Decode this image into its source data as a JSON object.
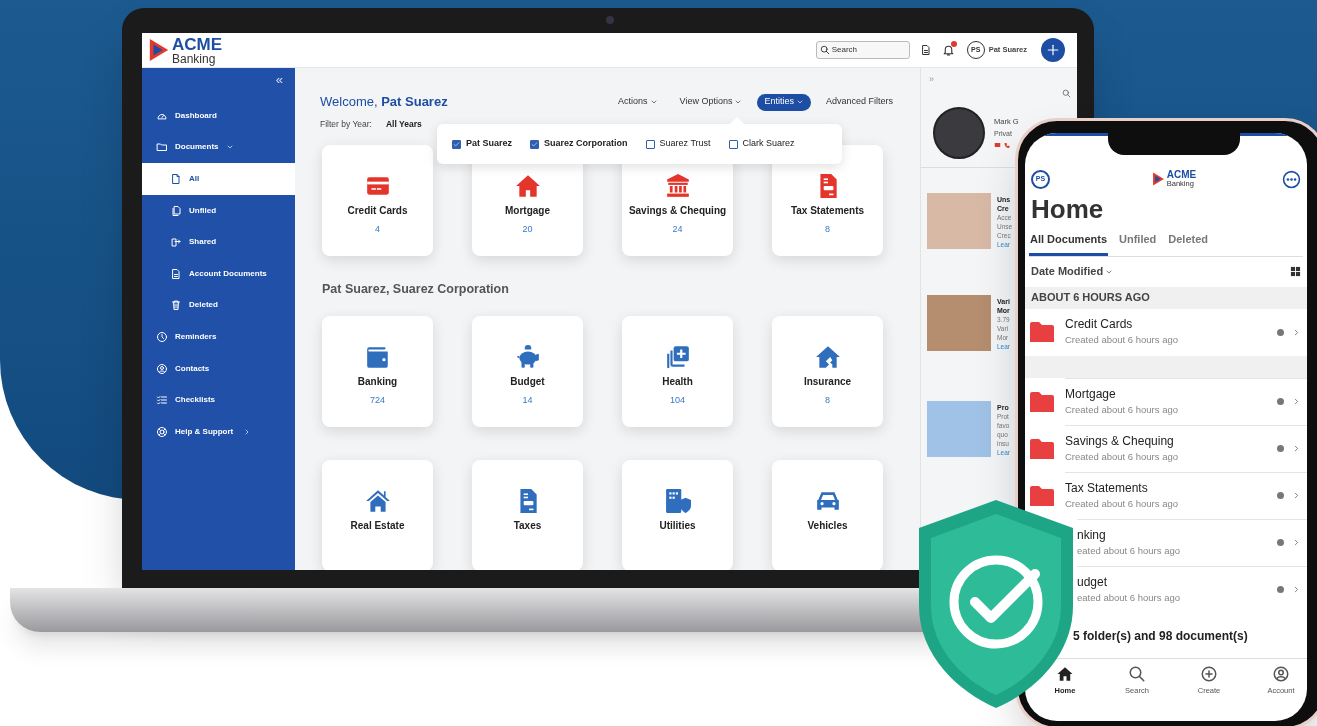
{
  "laptop": {
    "header": {
      "logo_title": "ACME",
      "logo_subtitle": "Banking",
      "search_placeholder": "Search",
      "has_notification": true,
      "user_initials": "PS",
      "user_name": "Pat Suarez"
    },
    "sidebar": {
      "collapse_label": "«",
      "items": [
        {
          "label": "Dashboard",
          "selected": false
        },
        {
          "label": "Documents",
          "selected": false,
          "expanded": true,
          "children": [
            {
              "label": "All",
              "selected": true
            },
            {
              "label": "Unfiled",
              "selected": false
            },
            {
              "label": "Shared",
              "selected": false
            },
            {
              "label": "Account Documents",
              "selected": false
            },
            {
              "label": "Deleted",
              "selected": false
            }
          ]
        },
        {
          "label": "Reminders",
          "selected": false
        },
        {
          "label": "Contacts",
          "selected": false
        },
        {
          "label": "Checklists",
          "selected": false
        },
        {
          "label": "Help & Support",
          "selected": false,
          "expanded": false
        }
      ]
    },
    "main": {
      "welcome": "Welcome, **Pat Suarez**",
      "toolbar": [
        {
          "label": "Actions",
          "has_caret": true,
          "selected": false
        },
        {
          "label": "View Options",
          "has_caret": true,
          "selected": false
        },
        {
          "label": "Entities",
          "has_caret": true,
          "selected": true
        },
        {
          "label": "Advanced Filters",
          "has_caret": false,
          "selected": false
        }
      ],
      "filter_label": "Filter by Year:",
      "filter_value": "All Years",
      "entity_options": [
        {
          "label": "Pat Suarez",
          "checked": true
        },
        {
          "label": "Suarez Corporation",
          "checked": true
        },
        {
          "label": "Suarez Trust",
          "checked": false
        },
        {
          "label": "Clark Suarez",
          "checked": false
        }
      ],
      "top_folders": [
        {
          "label": "Credit Cards",
          "count": "4"
        },
        {
          "label": "Mortgage",
          "count": "20"
        },
        {
          "label": "Savings & Chequing",
          "count": "24"
        },
        {
          "label": "Tax Statements",
          "count": "8"
        }
      ],
      "section_title": "Pat Suarez, Suarez Corporation",
      "folders": [
        {
          "label": "Banking",
          "count": "724"
        },
        {
          "label": "Budget",
          "count": "14"
        },
        {
          "label": "Health",
          "count": "104"
        },
        {
          "label": "Insurance",
          "count": "8"
        },
        {
          "label": "Real Estate"
        },
        {
          "label": "Taxes"
        },
        {
          "label": "Utilities"
        },
        {
          "label": "Vehicles"
        }
      ]
    },
    "right_panel": {
      "expand_label": "»",
      "advisor_name": "Mark G",
      "advisor_title": "Privat",
      "articles": [
        {
          "title_lines": [
            "Uns",
            "Cre"
          ],
          "body_lines": [
            "Acce",
            "Unse",
            "Crec"
          ],
          "link": "Lear"
        },
        {
          "title_lines": [
            "Vari",
            "Mor"
          ],
          "body_lines": [
            "3.79",
            "Vari",
            "Mor"
          ],
          "link": "Lear"
        },
        {
          "title_lines": [
            "Pro"
          ],
          "body_lines": [
            "Prot",
            "favo",
            "quo",
            "insu"
          ],
          "link": "Lear"
        }
      ]
    }
  },
  "phone": {
    "user_initials": "PS",
    "logo_title": "ACME",
    "logo_subtitle": "Banking",
    "title": "Home",
    "tabs": [
      {
        "label": "All Documents",
        "selected": true
      },
      {
        "label": "Unfiled",
        "selected": false
      },
      {
        "label": "Deleted",
        "selected": false
      }
    ],
    "sort_label": "Date Modified",
    "group_header": "ABOUT 6 HOURS AGO",
    "items": [
      {
        "kind": "folder",
        "title": "Credit Cards",
        "subtitle": "Created about 6 hours ago",
        "gap_after": true
      },
      {
        "kind": "folder",
        "title": "Mortgage",
        "subtitle": "Created about 6 hours ago"
      },
      {
        "kind": "folder",
        "title": "Savings & Chequing",
        "subtitle": "Created about 6 hours ago"
      },
      {
        "kind": "folder",
        "title": "Tax Statements",
        "subtitle": "Created about 6 hours ago"
      },
      {
        "kind": "covered",
        "title": "nking",
        "subtitle": "eated about 6 hours ago"
      },
      {
        "kind": "covered",
        "title": "udget",
        "subtitle": "eated about 6 hours ago"
      }
    ],
    "summary": "5 folder(s) and 98 document(s)",
    "nav": [
      {
        "label": "Home",
        "selected": true
      },
      {
        "label": "Search",
        "selected": false
      },
      {
        "label": "Create",
        "selected": false
      },
      {
        "label": "Account",
        "selected": false
      }
    ]
  }
}
